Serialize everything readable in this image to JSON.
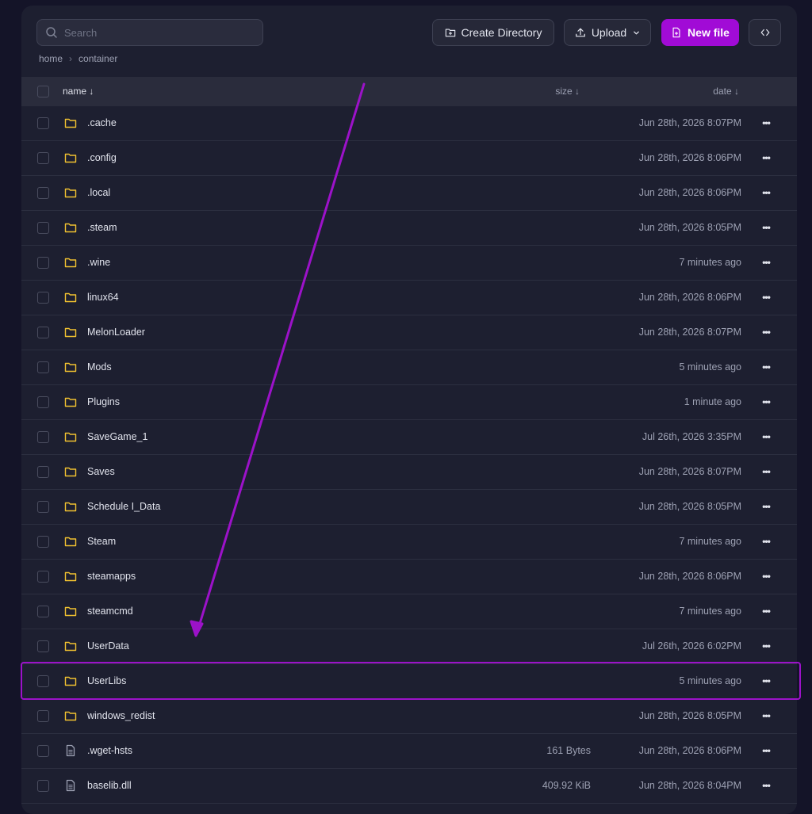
{
  "toolbar": {
    "search_placeholder": "Search",
    "create_directory_label": "Create Directory",
    "upload_label": "Upload",
    "new_file_label": "New file"
  },
  "breadcrumb": {
    "items": [
      "home",
      "container"
    ]
  },
  "table": {
    "headers": {
      "name": "name ↓",
      "size": "size ↓",
      "date": "date ↓"
    },
    "rows": [
      {
        "name": ".cache",
        "type": "folder",
        "size": "",
        "date": "Jun 28th, 2026 8:07PM"
      },
      {
        "name": ".config",
        "type": "folder",
        "size": "",
        "date": "Jun 28th, 2026 8:06PM"
      },
      {
        "name": ".local",
        "type": "folder",
        "size": "",
        "date": "Jun 28th, 2026 8:06PM"
      },
      {
        "name": ".steam",
        "type": "folder",
        "size": "",
        "date": "Jun 28th, 2026 8:05PM"
      },
      {
        "name": ".wine",
        "type": "folder",
        "size": "",
        "date": "7 minutes ago"
      },
      {
        "name": "linux64",
        "type": "folder",
        "size": "",
        "date": "Jun 28th, 2026 8:06PM"
      },
      {
        "name": "MelonLoader",
        "type": "folder",
        "size": "",
        "date": "Jun 28th, 2026 8:07PM"
      },
      {
        "name": "Mods",
        "type": "folder",
        "size": "",
        "date": "5 minutes ago"
      },
      {
        "name": "Plugins",
        "type": "folder",
        "size": "",
        "date": "1 minute ago"
      },
      {
        "name": "SaveGame_1",
        "type": "folder",
        "size": "",
        "date": "Jul 26th, 2026 3:35PM"
      },
      {
        "name": "Saves",
        "type": "folder",
        "size": "",
        "date": "Jun 28th, 2026 8:07PM"
      },
      {
        "name": "Schedule I_Data",
        "type": "folder",
        "size": "",
        "date": "Jun 28th, 2026 8:05PM"
      },
      {
        "name": "Steam",
        "type": "folder",
        "size": "",
        "date": "7 minutes ago"
      },
      {
        "name": "steamapps",
        "type": "folder",
        "size": "",
        "date": "Jun 28th, 2026 8:06PM"
      },
      {
        "name": "steamcmd",
        "type": "folder",
        "size": "",
        "date": "7 minutes ago"
      },
      {
        "name": "UserData",
        "type": "folder",
        "size": "",
        "date": "Jul 26th, 2026 6:02PM"
      },
      {
        "name": "UserLibs",
        "type": "folder",
        "size": "",
        "date": "5 minutes ago"
      },
      {
        "name": "windows_redist",
        "type": "folder",
        "size": "",
        "date": "Jun 28th, 2026 8:05PM"
      },
      {
        "name": ".wget-hsts",
        "type": "file",
        "size": "161 Bytes",
        "date": "Jun 28th, 2026 8:06PM"
      },
      {
        "name": "baselib.dll",
        "type": "file",
        "size": "409.92 KiB",
        "date": "Jun 28th, 2026 8:04PM"
      }
    ]
  },
  "colors": {
    "accent": "#a10bd6",
    "annotation": "#9c12c9",
    "folder_icon": "#f2c230",
    "background": "#141428",
    "panel": "#1d1f30"
  },
  "icons": {
    "search": "search-icon",
    "create_directory": "folder-plus-icon",
    "upload": "upload-icon",
    "new_file": "file-plus-icon",
    "code": "code-icon",
    "folder": "folder-icon",
    "file": "file-icon",
    "more": "more-icon"
  }
}
